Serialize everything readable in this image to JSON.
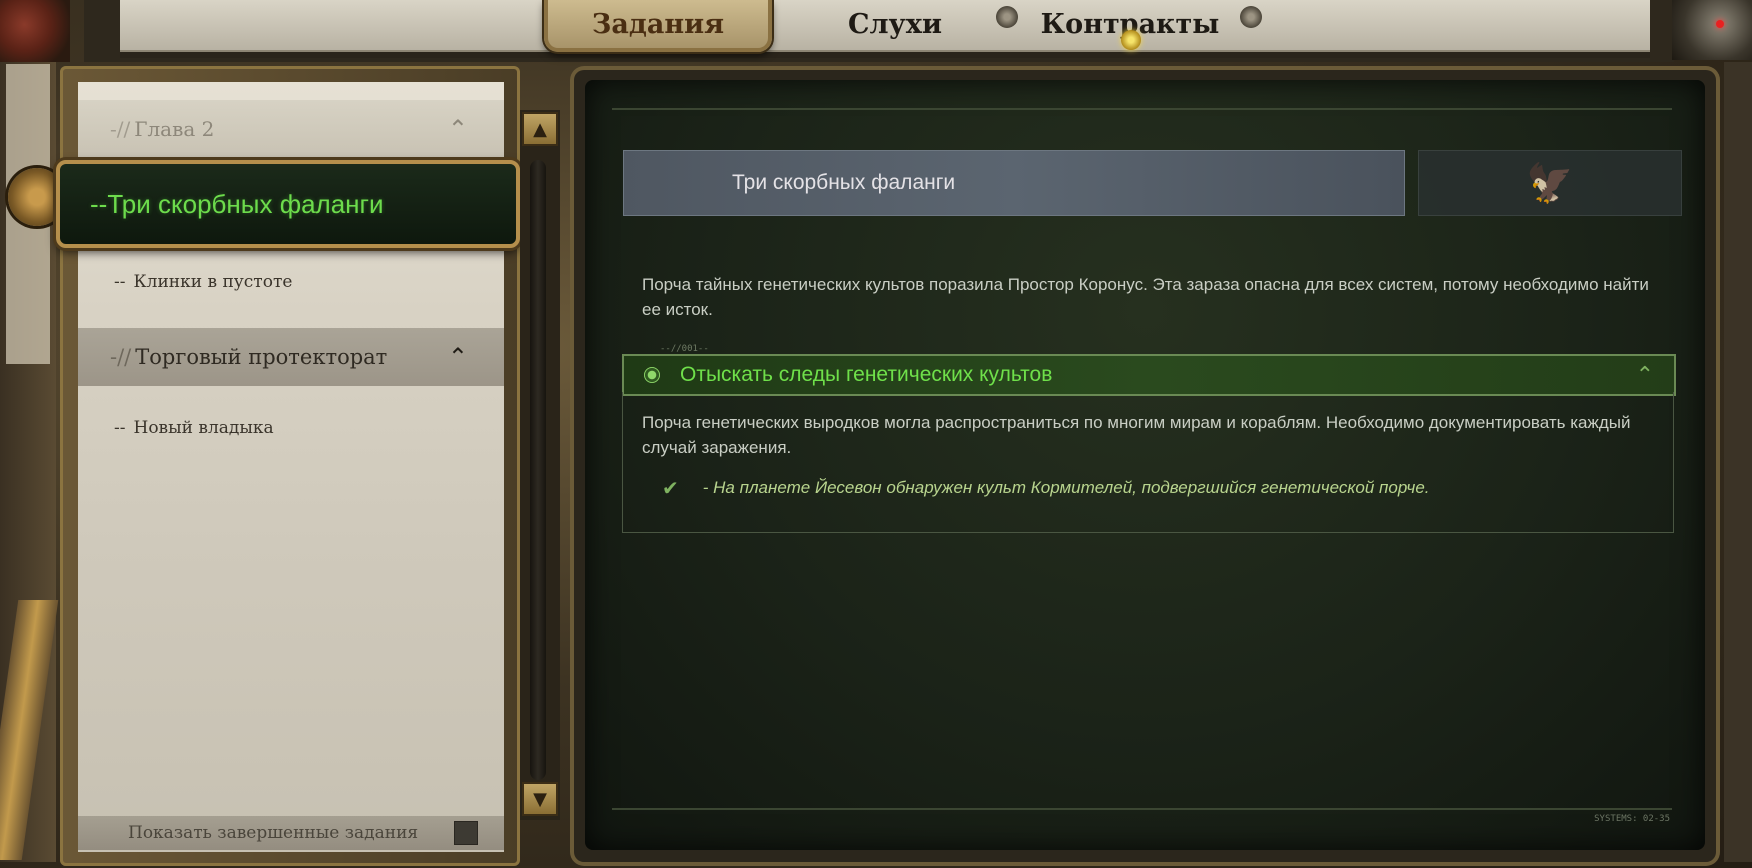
{
  "tabs": [
    {
      "label": "Задания",
      "active": true
    },
    {
      "label": "Слухи",
      "active": false
    },
    {
      "label": "Контракты",
      "active": false
    }
  ],
  "sidebar": {
    "chapter": {
      "prefix": "-//",
      "label": "Глава 2",
      "chevron": "⌃"
    },
    "active_quest": {
      "label": "--Три скорбных фаланги"
    },
    "subquest_1": {
      "prefix": "--",
      "label": "Клинки в пустоте"
    },
    "group": {
      "prefix": "-//",
      "label": "Торговый протекторат",
      "chevron": "⌃"
    },
    "subquest_2": {
      "prefix": "--",
      "label": "Новый владыка"
    },
    "show_completed": {
      "label": "Показать завершенные задания",
      "checked": false
    }
  },
  "quest": {
    "icon": "skull-badge-icon",
    "title": "Три скорбных фаланги",
    "emblem": "imperial-aquila-icon",
    "description": "Порча тайных генетических культов поразила Простор Коронус. Эта зараза опасна для всех систем, потому необходимо найти ее исток.",
    "objective": {
      "tag": "--//001--",
      "title": "Отыскать следы генетических культов",
      "description": "Порча генетических выродков могла распространиться по многим мирам и кораблям. Необходимо документировать каждый случай заражения.",
      "completed_entry": "- На планете Йесевон обнаружен культ Кормителей, подвергшийся генетической порче."
    },
    "system_label": "SYSTEMS: 02-35"
  },
  "colors": {
    "accent_green": "#6fe04a",
    "completed_text": "#b8d48e",
    "brass": "#b58f4c"
  }
}
